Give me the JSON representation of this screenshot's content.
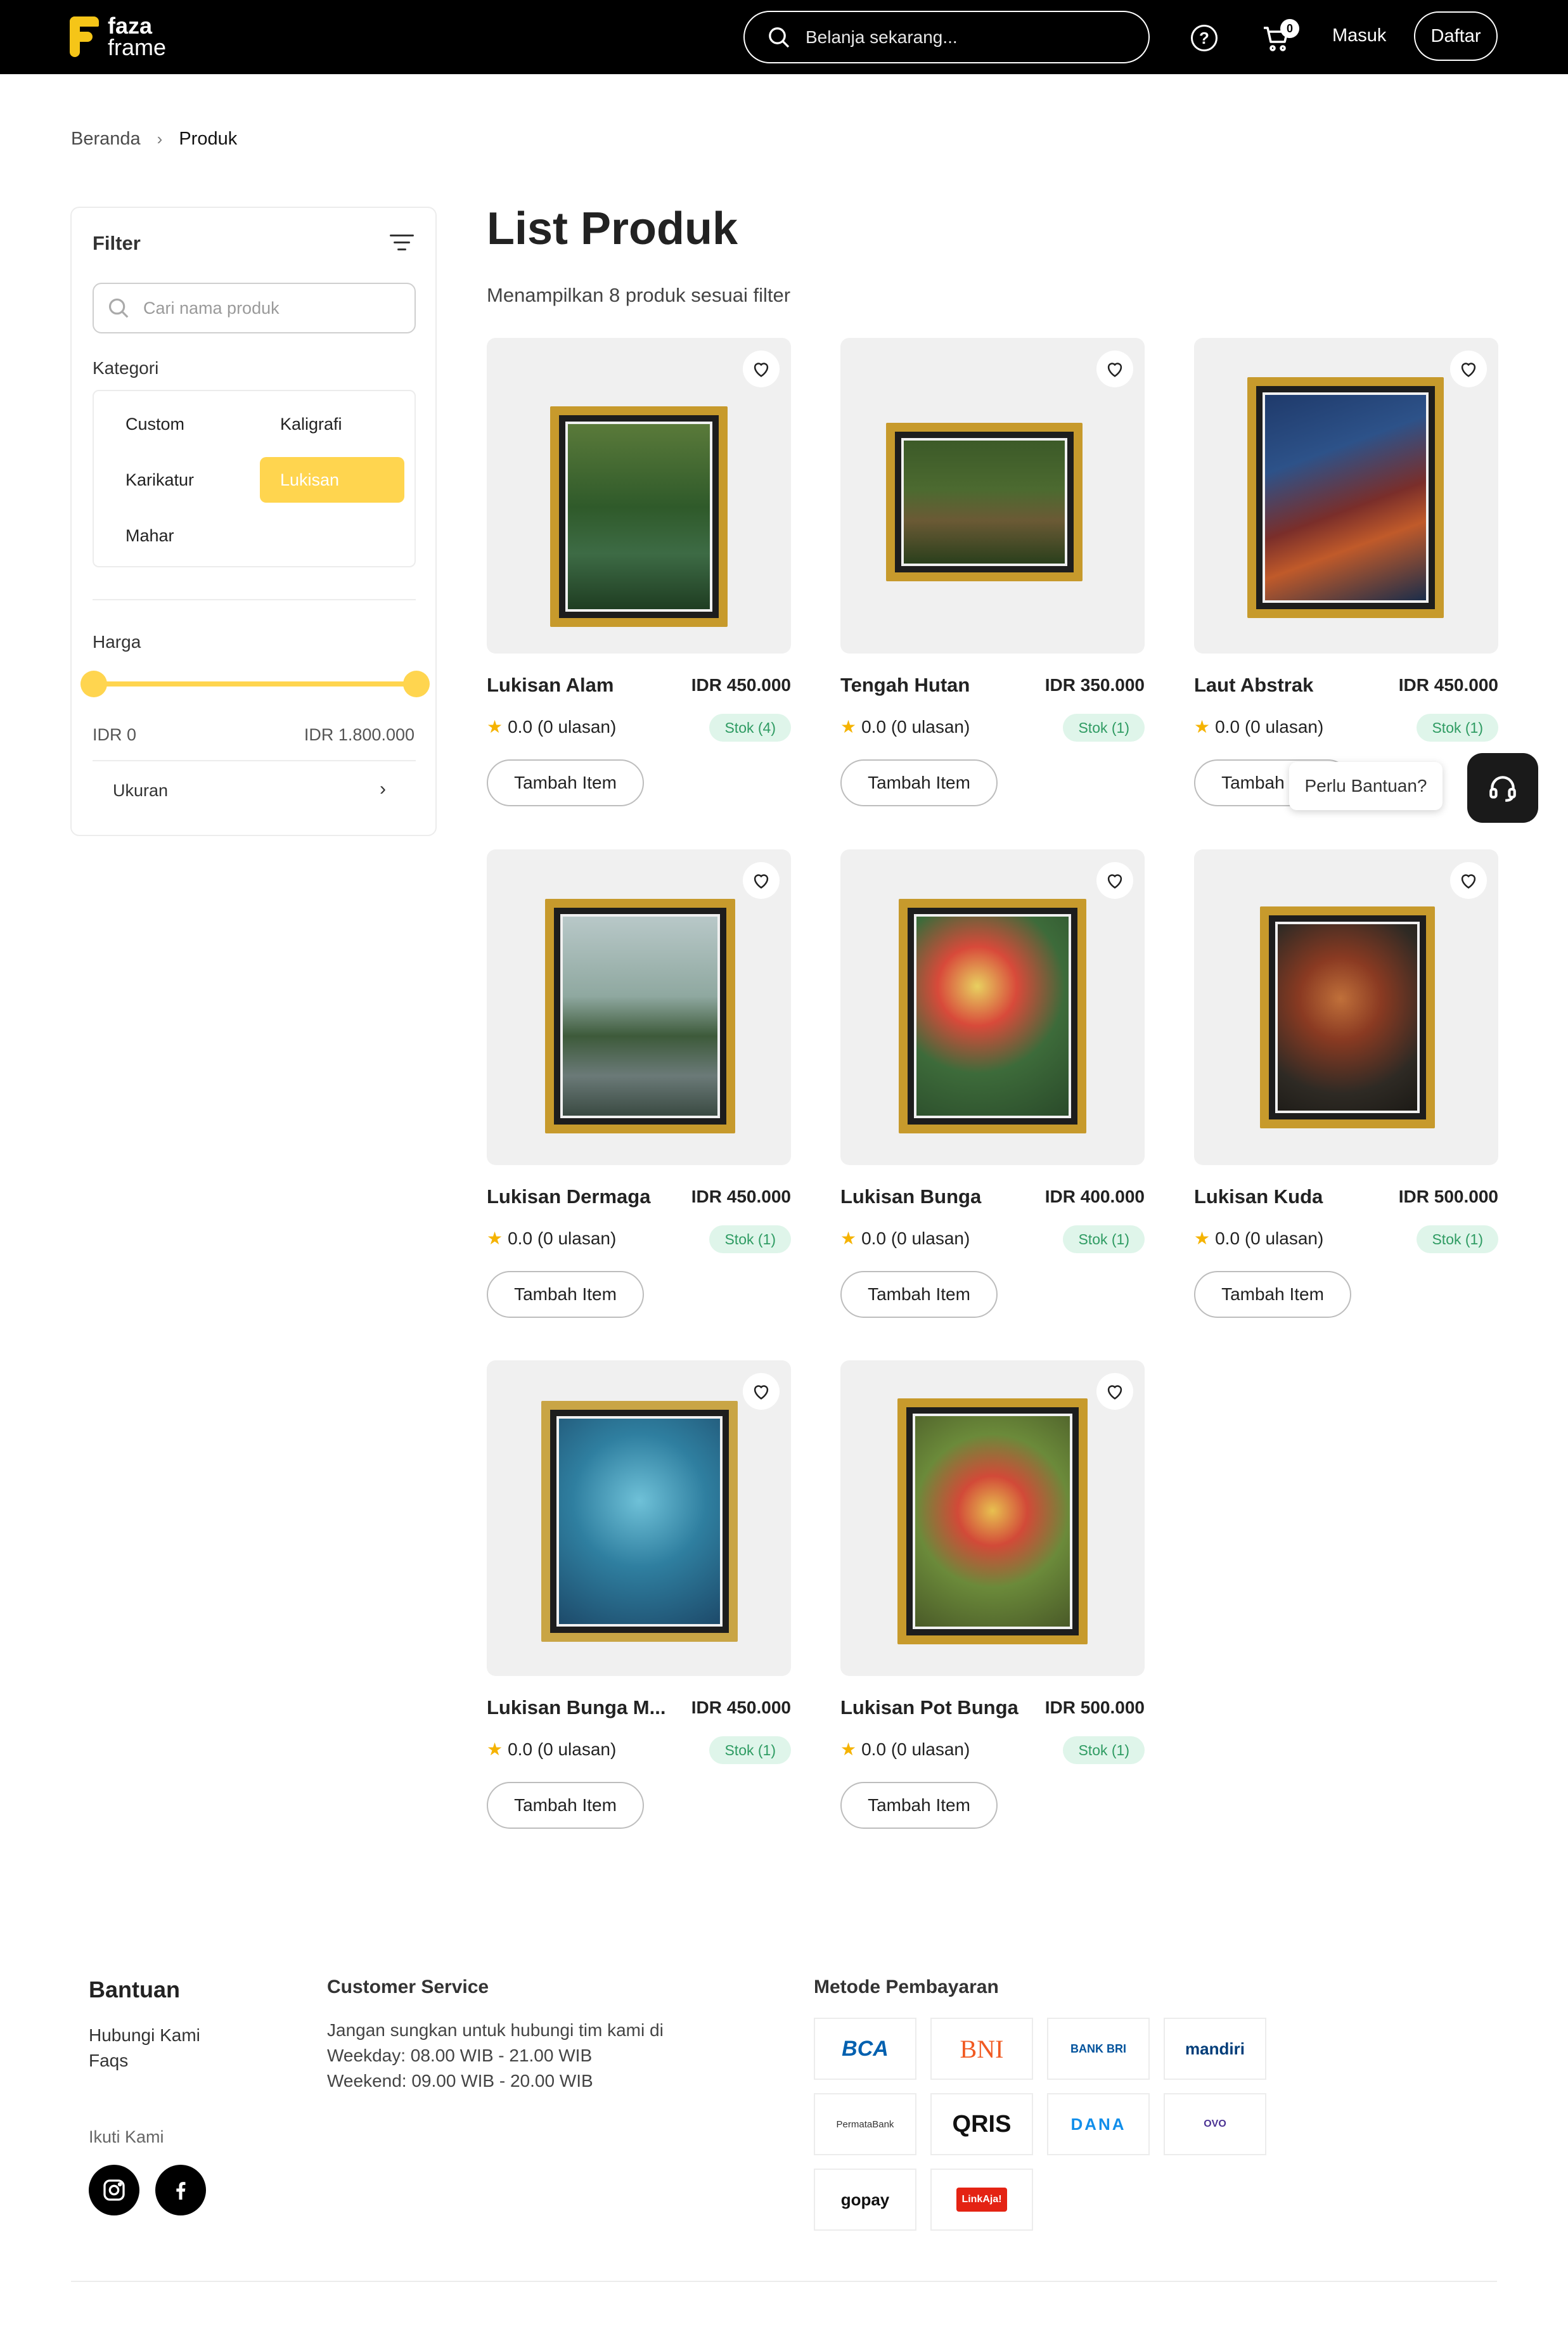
{
  "header": {
    "logo_line1": "faza",
    "logo_line2": "frame",
    "search_placeholder": "Belanja sekarang...",
    "help_glyph": "?",
    "cart_count": "0",
    "login_label": "Masuk",
    "register_label": "Daftar"
  },
  "breadcrumb": {
    "home": "Beranda",
    "separator": "›",
    "current": "Produk"
  },
  "filter": {
    "title": "Filter",
    "search_placeholder": "Cari nama produk",
    "category_label": "Kategori",
    "categories": [
      {
        "label": "Custom",
        "active": false
      },
      {
        "label": "Kaligrafi",
        "active": false
      },
      {
        "label": "Karikatur",
        "active": false
      },
      {
        "label": "Lukisan",
        "active": true
      },
      {
        "label": "Mahar",
        "active": false
      }
    ],
    "price_label": "Harga",
    "price_min": "IDR 0",
    "price_max": "IDR 1.800.000",
    "price_range_fraction": [
      0,
      1
    ],
    "size_label": "Ukuran",
    "size_chevron": "›"
  },
  "main": {
    "title": "List Produk",
    "result_text": "Menampilkan 8 produk sesuai filter",
    "add_label": "Tambah Item",
    "products": [
      {
        "name": "Lukisan Alam",
        "price": "IDR 450.000",
        "rating": "0.0 (0 ulasan)",
        "stock": "Stok (4)"
      },
      {
        "name": "Tengah Hutan",
        "price": "IDR 350.000",
        "rating": "0.0 (0 ulasan)",
        "stock": "Stok (1)"
      },
      {
        "name": "Laut Abstrak",
        "price": "IDR 450.000",
        "rating": "0.0 (0 ulasan)",
        "stock": "Stok (1)"
      },
      {
        "name": "Lukisan Dermaga",
        "price": "IDR 450.000",
        "rating": "0.0 (0 ulasan)",
        "stock": "Stok (1)"
      },
      {
        "name": "Lukisan Bunga",
        "price": "IDR 400.000",
        "rating": "0.0 (0 ulasan)",
        "stock": "Stok (1)"
      },
      {
        "name": "Lukisan Kuda",
        "price": "IDR 500.000",
        "rating": "0.0 (0 ulasan)",
        "stock": "Stok (1)"
      },
      {
        "name": "Lukisan Bunga M...",
        "price": "IDR 450.000",
        "rating": "0.0 (0 ulasan)",
        "stock": "Stok (1)"
      },
      {
        "name": "Lukisan Pot Bunga",
        "price": "IDR 500.000",
        "rating": "0.0 (0 ulasan)",
        "stock": "Stok (1)"
      }
    ]
  },
  "help_widget": {
    "bubble_text": "Perlu Bantuan?"
  },
  "footer": {
    "help_title": "Bantuan",
    "links": [
      "Hubungi Kami",
      "Faqs"
    ],
    "follow_label": "Ikuti Kami",
    "cs_title": "Customer Service",
    "cs_lines": [
      "Jangan sungkan untuk hubungi tim kami di",
      "Weekday: 08.00 WIB - 21.00 WIB",
      "Weekend: 09.00 WIB - 20.00 WIB"
    ],
    "payment_title": "Metode Pembayaran",
    "payments": [
      "BCA",
      "BNI",
      "BANK BRI",
      "mandiri",
      "PermataBank",
      "QRIS",
      "DANA",
      "OVO",
      "gopay",
      "LinkAja!"
    ]
  },
  "colors": {
    "accent": "#ffd54f",
    "header_bg": "#000000",
    "stock_bg": "#dff5ea",
    "stock_text": "#2e9b62"
  }
}
